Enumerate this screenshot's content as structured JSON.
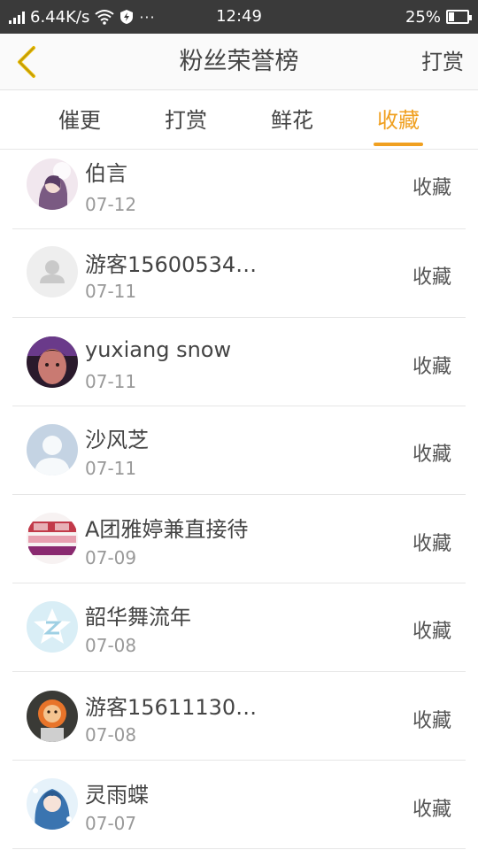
{
  "status_bar": {
    "speed": "6.44K/s",
    "dots": "···",
    "time": "12:49",
    "battery": "25%",
    "battery_level": 0.25
  },
  "header": {
    "title": "粉丝荣誉榜",
    "action": "打赏"
  },
  "tabs": [
    {
      "label": "催更",
      "active": false
    },
    {
      "label": "打赏",
      "active": false
    },
    {
      "label": "鲜花",
      "active": false
    },
    {
      "label": "收藏",
      "active": true
    }
  ],
  "rows": [
    {
      "name": "伯言",
      "date": "07-12",
      "action": "收藏",
      "avatar": "anime-girl-avatar"
    },
    {
      "name": "游客15600534…",
      "date": "07-11",
      "action": "收藏",
      "avatar": "default-person-avatar"
    },
    {
      "name": "yuxiang snow",
      "date": "07-11",
      "action": "收藏",
      "avatar": "photo-avatar"
    },
    {
      "name": "沙风芝",
      "date": "07-11",
      "action": "收藏",
      "avatar": "blue-silhouette-avatar"
    },
    {
      "name": "A团雅婷兼直接待",
      "date": "07-09",
      "action": "收藏",
      "avatar": "recruitment-sign-avatar"
    },
    {
      "name": "韶华舞流年",
      "date": "07-08",
      "action": "收藏",
      "avatar": "qzone-star-avatar"
    },
    {
      "name": "游客15611130…",
      "date": "07-08",
      "action": "收藏",
      "avatar": "lion-toy-avatar"
    },
    {
      "name": "灵雨蝶",
      "date": "07-07",
      "action": "收藏",
      "avatar": "anime-blue-hair-avatar"
    }
  ],
  "colors": {
    "accent": "#f0a020",
    "back_arrow": "#e6b800",
    "status_bar_bg": "#3a3a3a"
  }
}
